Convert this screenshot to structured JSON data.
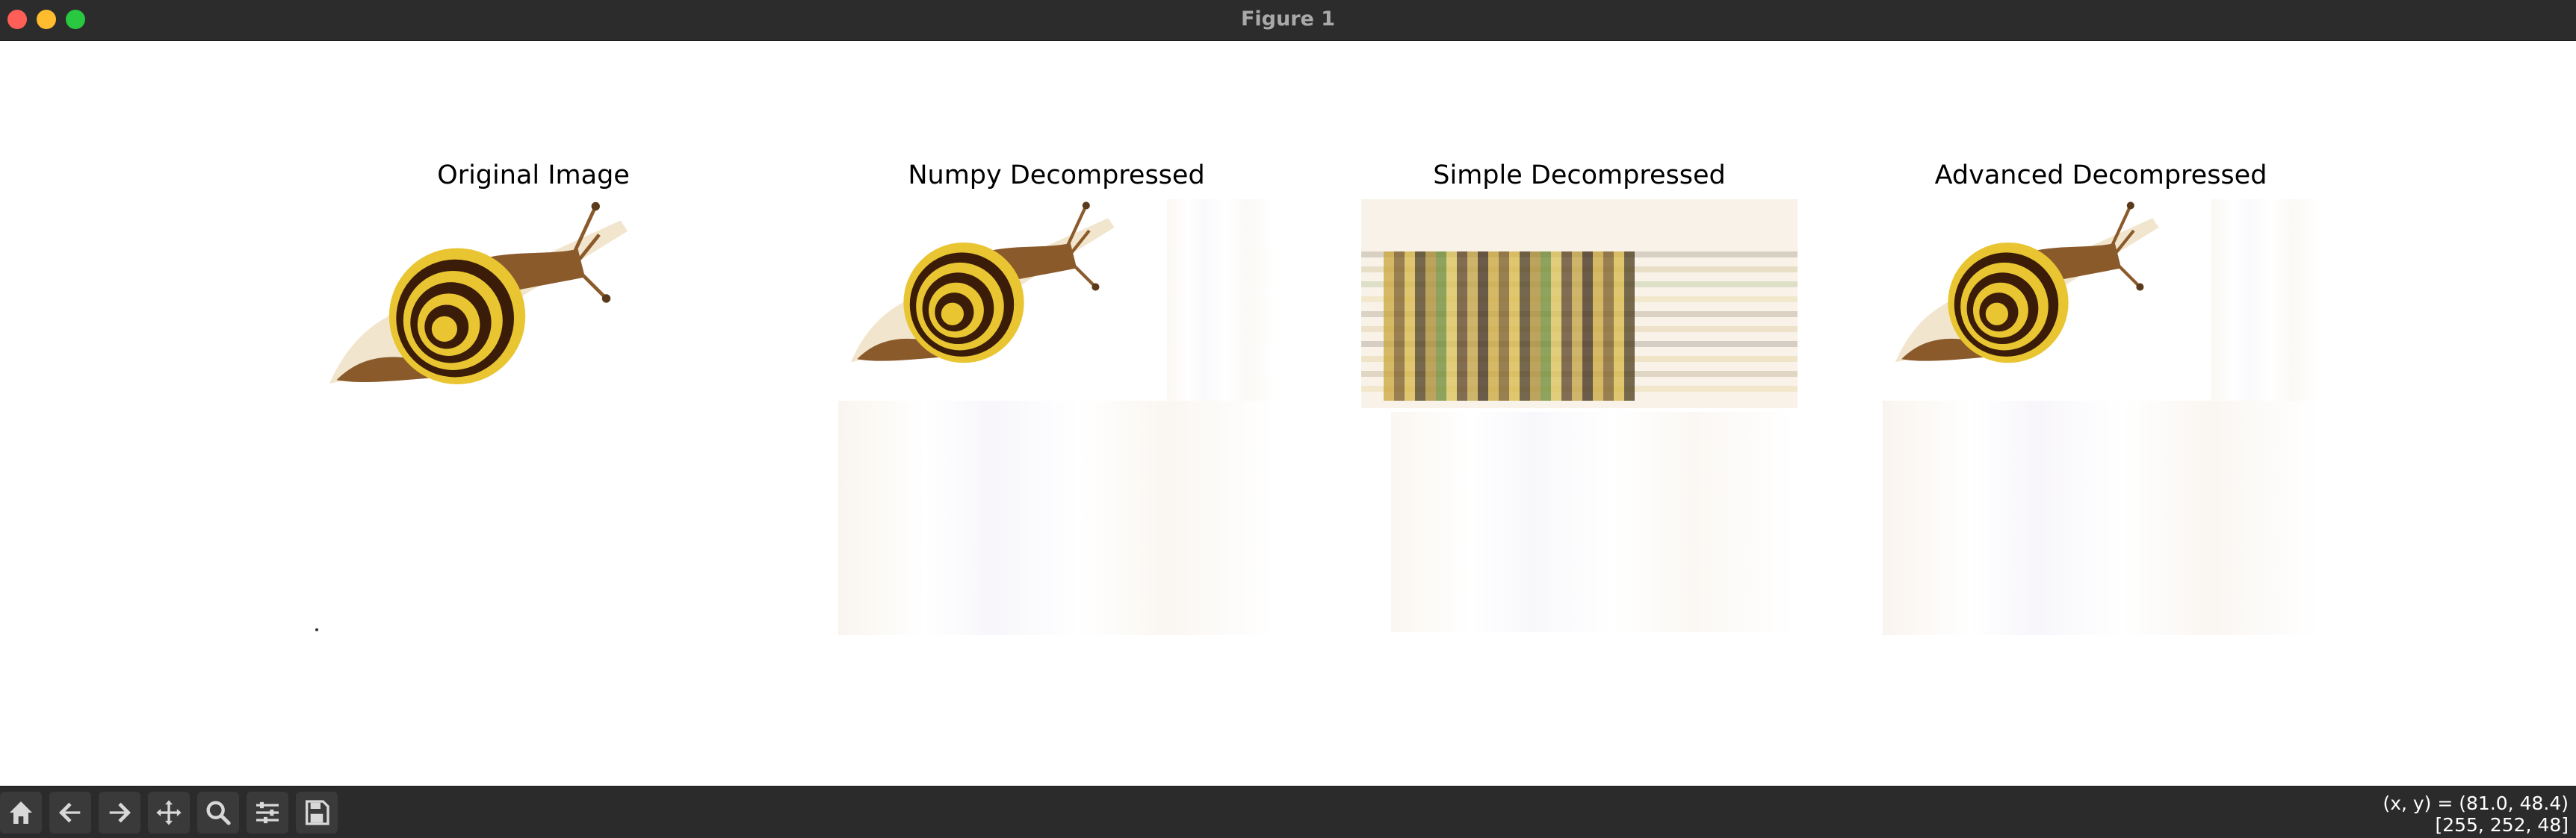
{
  "window": {
    "title": "Figure 1",
    "controls": [
      "close",
      "minimize",
      "maximize"
    ]
  },
  "subplots": [
    {
      "title": "Original Image",
      "variant": "original"
    },
    {
      "title": "Numpy Decompressed",
      "variant": "numpy"
    },
    {
      "title": "Simple Decompressed",
      "variant": "simple"
    },
    {
      "title": "Advanced Decompressed",
      "variant": "advanced"
    }
  ],
  "toolbar": {
    "tools": [
      {
        "name": "home",
        "icon": "home-icon"
      },
      {
        "name": "back",
        "icon": "arrow-left-icon"
      },
      {
        "name": "forward",
        "icon": "arrow-right-icon"
      },
      {
        "name": "pan",
        "icon": "move-icon"
      },
      {
        "name": "zoom",
        "icon": "magnifier-icon"
      },
      {
        "name": "configure-subplots",
        "icon": "sliders-icon"
      },
      {
        "name": "save",
        "icon": "floppy-disk-icon"
      }
    ],
    "coords": "(x, y) = (81.0, 48.4)",
    "pixel_value": "[255, 252, 48]"
  },
  "colors": {
    "titlebar": "#2c2c2c",
    "toolbar": "#2b2b2b",
    "shell_yellow": "#e8c531",
    "shell_stripe": "#3a1c08",
    "snail_body": "#8b5a2b"
  }
}
